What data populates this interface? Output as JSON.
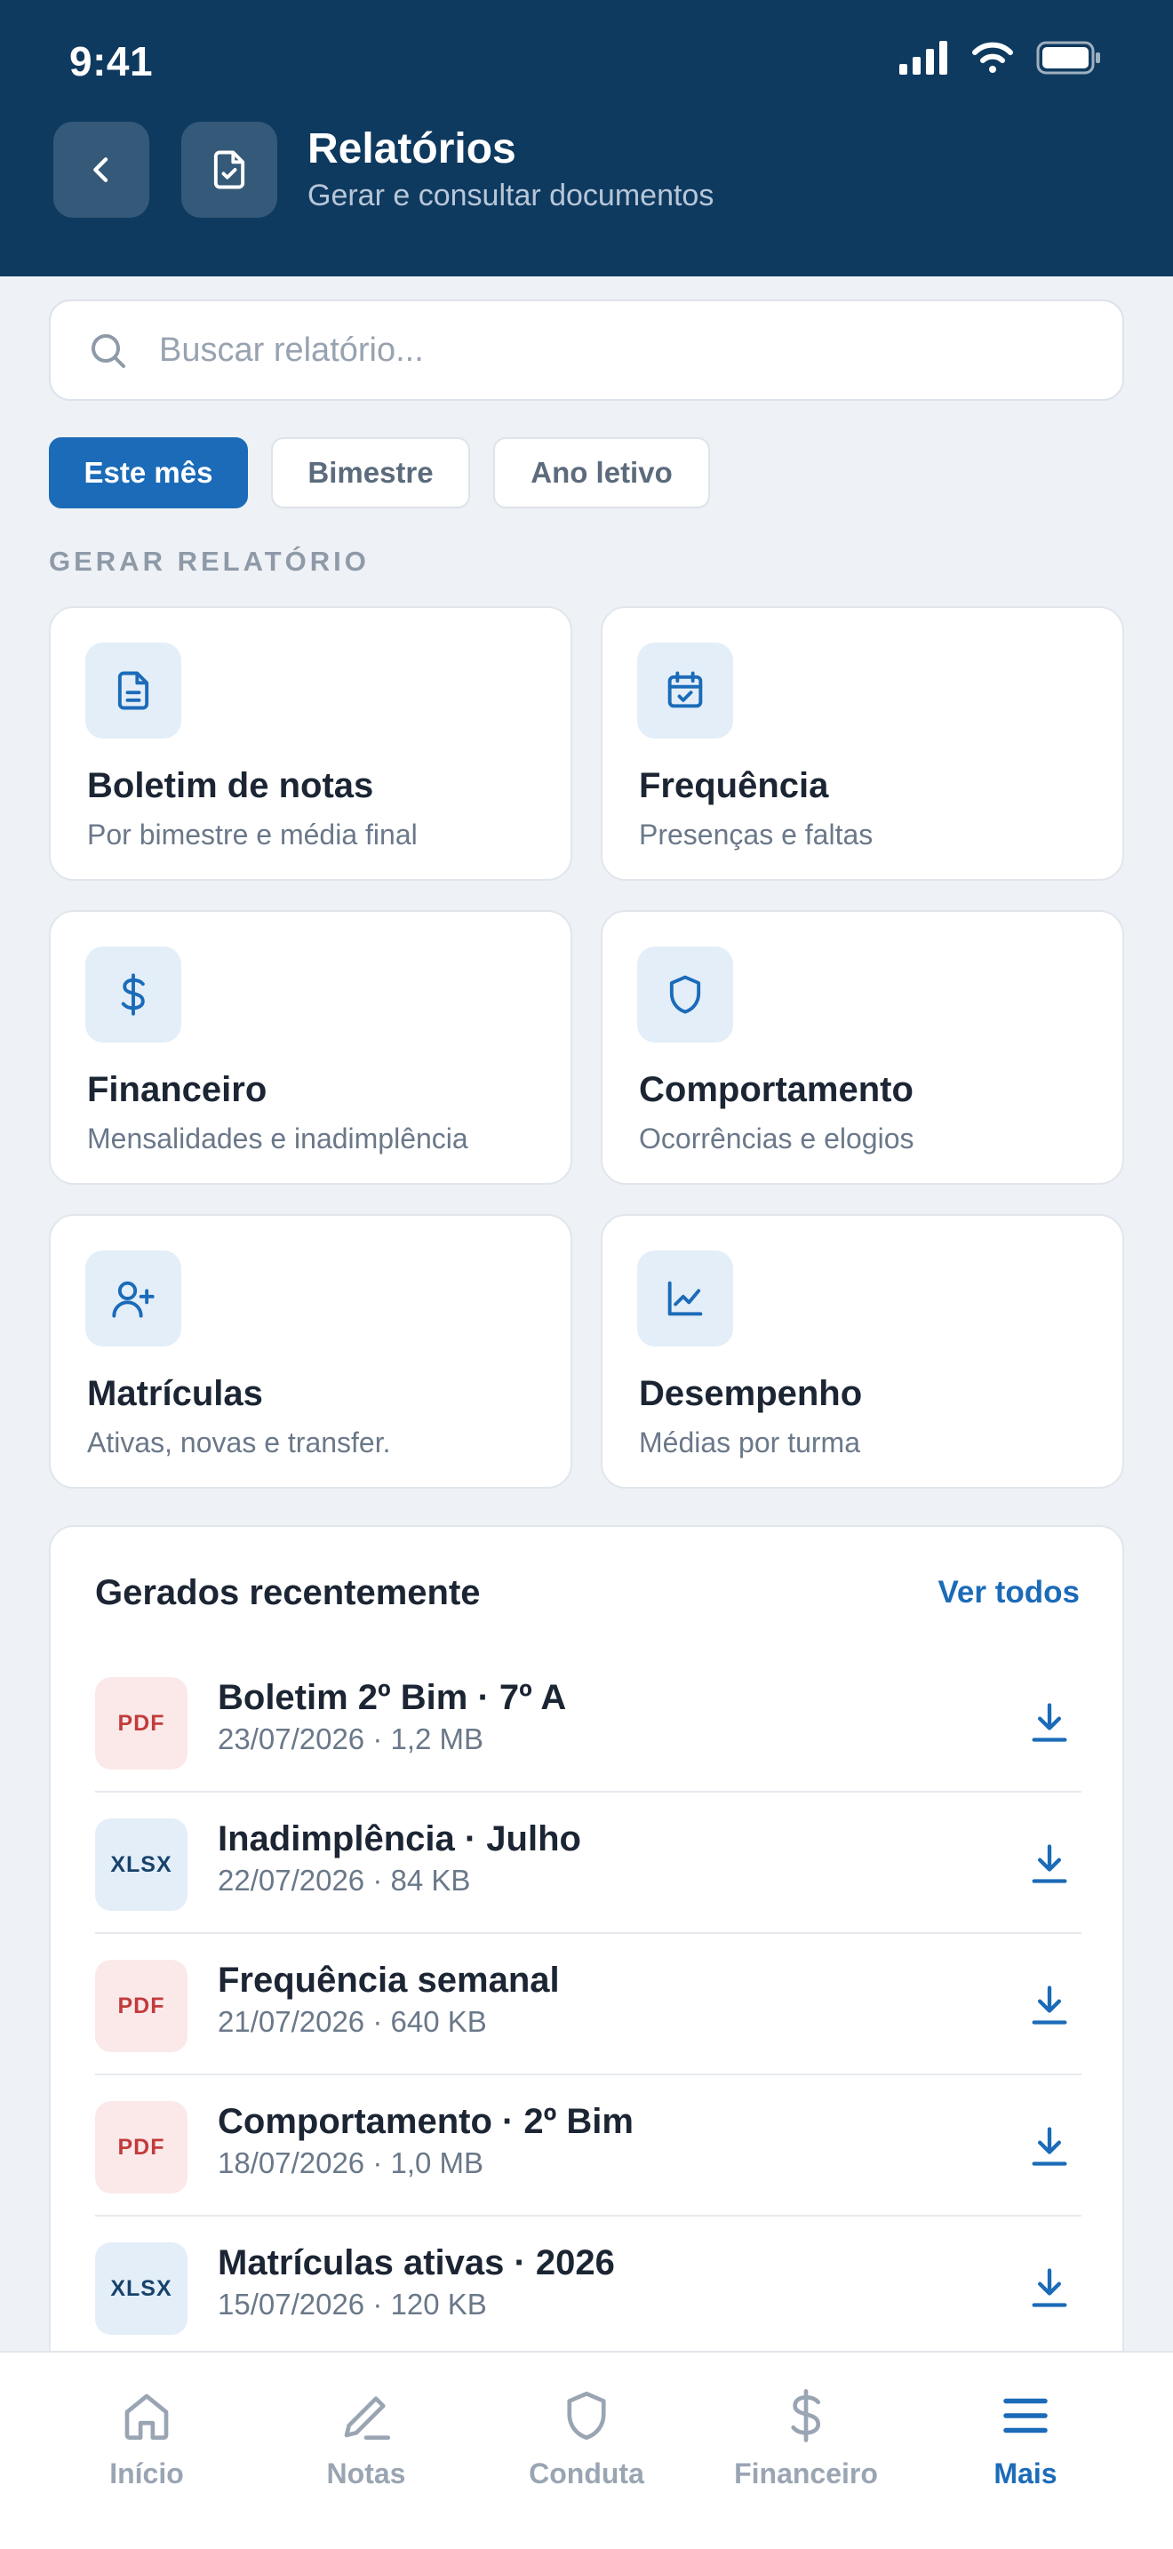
{
  "status_bar": {
    "time": "9:41"
  },
  "header": {
    "title": "Relatórios",
    "subtitle": "Gerar e consultar documentos",
    "back_icon": "chevron-left-icon",
    "doc_icon": "file-check-icon"
  },
  "search": {
    "placeholder": "Buscar relatório..."
  },
  "filters": [
    {
      "label": "Este mês",
      "active": true
    },
    {
      "label": "Bimestre",
      "active": false
    },
    {
      "label": "Ano letivo",
      "active": false
    }
  ],
  "generate_section": {
    "label": "GERAR RELATÓRIO",
    "cards": [
      {
        "title": "Boletim de notas",
        "subtitle": "Por bimestre e média final",
        "icon": "file-text-icon"
      },
      {
        "title": "Frequência",
        "subtitle": "Presenças e faltas",
        "icon": "calendar-check-icon"
      },
      {
        "title": "Financeiro",
        "subtitle": "Mensalidades e inadimplência",
        "icon": "dollar-icon"
      },
      {
        "title": "Comportamento",
        "subtitle": "Ocorrências e elogios",
        "icon": "shield-icon"
      },
      {
        "title": "Matrículas",
        "subtitle": "Ativas, novas e transfer.",
        "icon": "user-plus-icon"
      },
      {
        "title": "Desempenho",
        "subtitle": "Médias por turma",
        "icon": "line-chart-icon"
      }
    ]
  },
  "recent": {
    "title": "Gerados recentemente",
    "link": "Ver todos",
    "items": [
      {
        "type": "PDF",
        "name": "Boletim 2º Bim · 7º A",
        "meta": "23/07/2026 · 1,2 MB"
      },
      {
        "type": "XLSX",
        "name": "Inadimplência · Julho",
        "meta": "22/07/2026 · 84 KB"
      },
      {
        "type": "PDF",
        "name": "Frequência semanal",
        "meta": "21/07/2026 · 640 KB"
      },
      {
        "type": "PDF",
        "name": "Comportamento · 2º Bim",
        "meta": "18/07/2026 · 1,0 MB"
      },
      {
        "type": "XLSX",
        "name": "Matrículas ativas · 2026",
        "meta": "15/07/2026 · 120 KB"
      }
    ]
  },
  "tabbar": [
    {
      "label": "Início",
      "icon": "home-icon",
      "active": false
    },
    {
      "label": "Notas",
      "icon": "pencil-icon",
      "active": false
    },
    {
      "label": "Conduta",
      "icon": "shield-icon",
      "active": false
    },
    {
      "label": "Financeiro",
      "icon": "dollar-icon",
      "active": false
    },
    {
      "label": "Mais",
      "icon": "menu-icon",
      "active": true
    }
  ],
  "colors": {
    "header": "#0f3a60",
    "accent": "#1b6bb8",
    "background": "#eef1f5",
    "pdf": "#c23b3b"
  }
}
